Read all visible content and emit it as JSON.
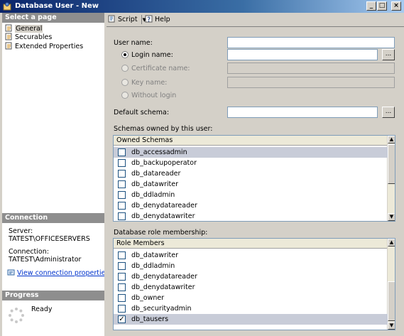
{
  "window": {
    "title": "Database User - New",
    "buttons": {
      "minimize": "_",
      "maximize": "□",
      "close": "×"
    }
  },
  "left": {
    "select_page_header": "Select a page",
    "pages": [
      {
        "label": "General",
        "icon": "page-icon"
      },
      {
        "label": "Securables",
        "icon": "page-icon"
      },
      {
        "label": "Extended Properties",
        "icon": "page-icon"
      }
    ],
    "connection_header": "Connection",
    "server_label": "Server:",
    "server_value": "TATEST\\OFFICESERVERS",
    "connection_label": "Connection:",
    "connection_value": "TATEST\\Administrator",
    "view_connection_link": "View connection properties",
    "progress_header": "Progress",
    "progress_status": "Ready"
  },
  "toolbar": {
    "script_label": "Script",
    "help_label": "Help"
  },
  "form": {
    "user_name_label": "User name:",
    "user_name_value": "",
    "login_name_label": "Login name:",
    "login_name_value": "",
    "certificate_label": "Certificate name:",
    "key_label": "Key name:",
    "without_login_label": "Without login",
    "default_schema_label": "Default schema:",
    "default_schema_value": "",
    "browse_label": "...",
    "selected_option": "Login name"
  },
  "schemas": {
    "section_label": "Schemas owned by this user:",
    "column_header": "Owned Schemas",
    "rows": [
      {
        "name": "db_accessadmin",
        "checked": false,
        "selected": true
      },
      {
        "name": "db_backupoperator",
        "checked": false,
        "selected": false
      },
      {
        "name": "db_datareader",
        "checked": false,
        "selected": false
      },
      {
        "name": "db_datawriter",
        "checked": false,
        "selected": false
      },
      {
        "name": "db_ddladmin",
        "checked": false,
        "selected": false
      },
      {
        "name": "db_denydatareader",
        "checked": false,
        "selected": false
      },
      {
        "name": "db_denydatawriter",
        "checked": false,
        "selected": false
      }
    ]
  },
  "roles": {
    "section_label": "Database role membership:",
    "column_header": "Role Members",
    "rows": [
      {
        "name": "db_datawriter",
        "checked": false,
        "selected": false
      },
      {
        "name": "db_ddladmin",
        "checked": false,
        "selected": false
      },
      {
        "name": "db_denydatareader",
        "checked": false,
        "selected": false
      },
      {
        "name": "db_denydatawriter",
        "checked": false,
        "selected": false
      },
      {
        "name": "db_owner",
        "checked": false,
        "selected": false
      },
      {
        "name": "db_securityadmin",
        "checked": false,
        "selected": false
      },
      {
        "name": "db_tausers",
        "checked": true,
        "selected": true
      }
    ]
  },
  "scroll": {
    "up": "▲",
    "down": "▼"
  },
  "checkmark": "✓"
}
